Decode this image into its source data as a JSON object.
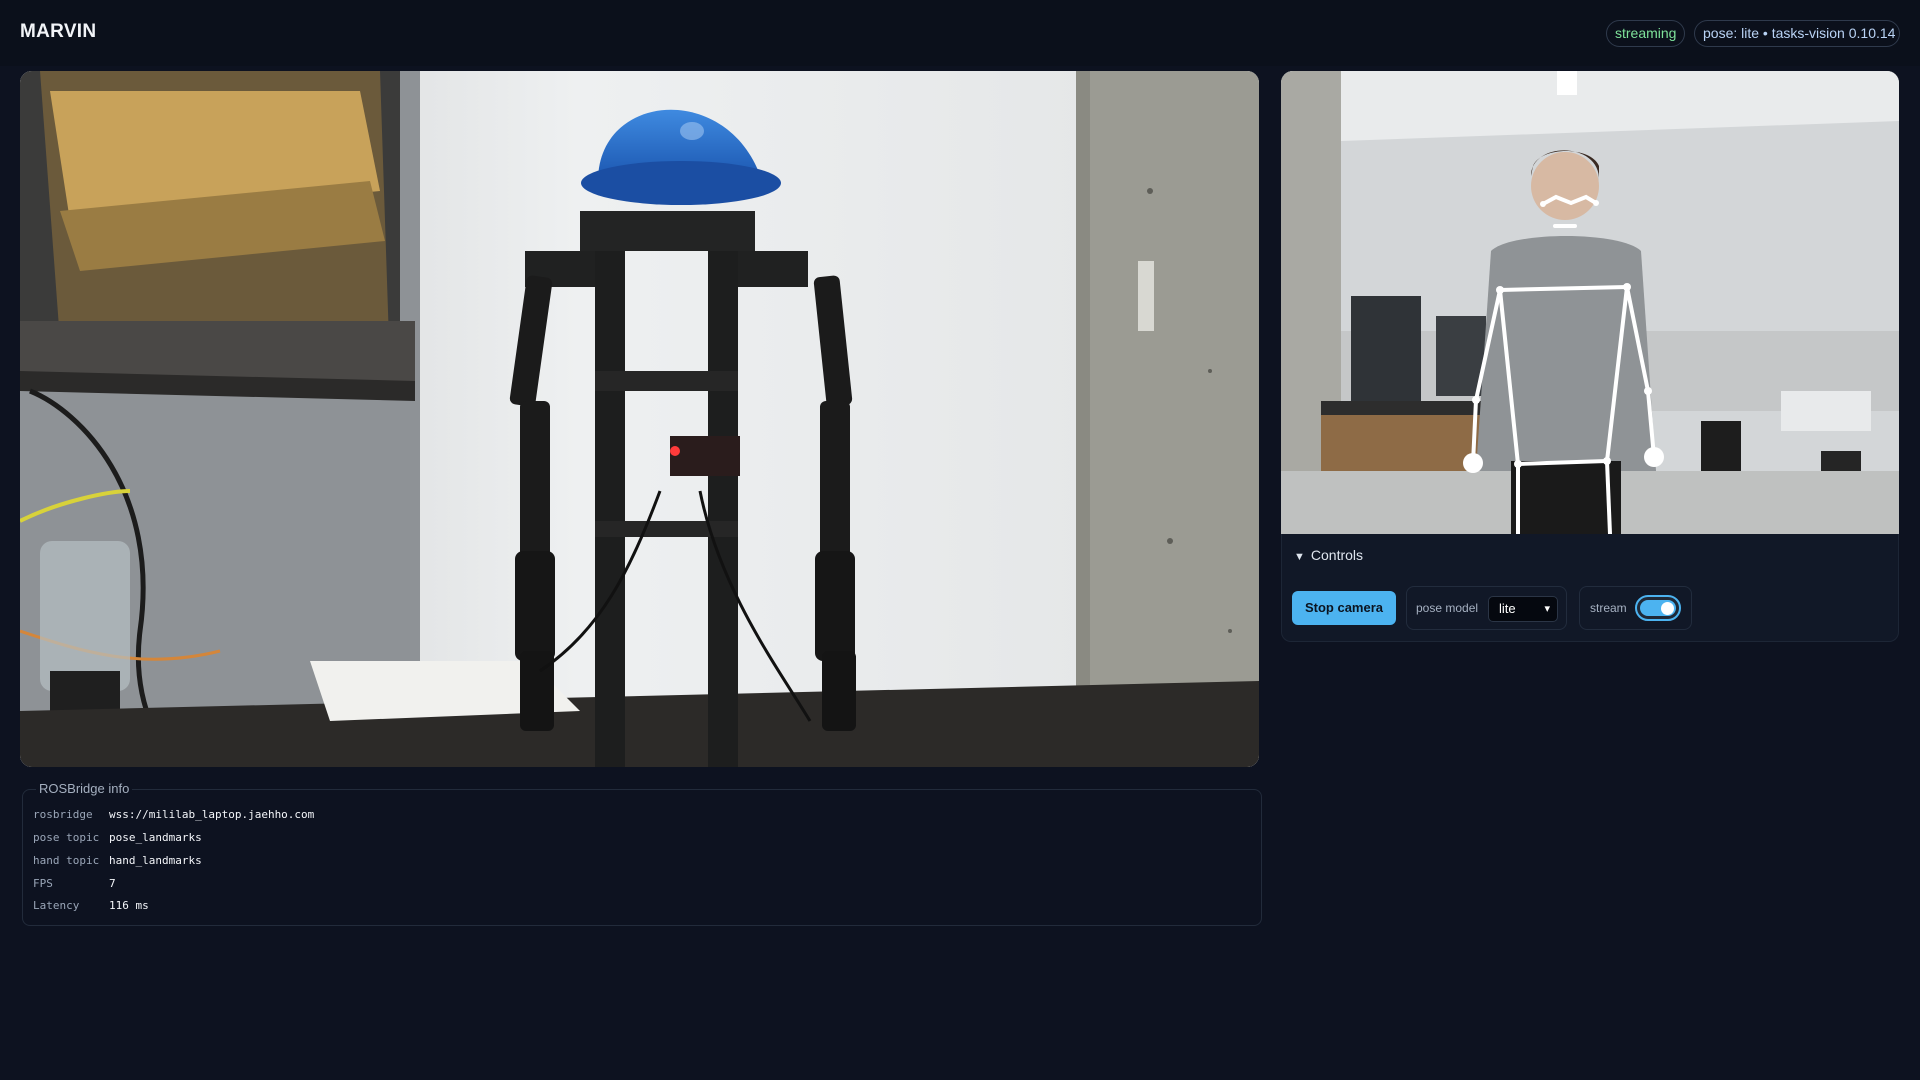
{
  "app": {
    "title": "MARVIN"
  },
  "header": {
    "status_badge": "streaming",
    "pose_badge": "pose: lite • tasks-vision 0.10.14",
    "colors": {
      "status": "#7ee29a",
      "pose": "#b9d3f5"
    }
  },
  "controls": {
    "summary": "Controls",
    "stop_label": "Stop camera",
    "pose_model_label": "pose model",
    "pose_model_value": "lite",
    "stream_label": "stream",
    "stream_on": true
  },
  "ros": {
    "legend": "ROSBridge info",
    "rows": [
      {
        "key": "rosbridge",
        "value": "wss://mililab_laptop.jaehho.com"
      },
      {
        "key": "pose topic",
        "value": "pose_landmarks"
      },
      {
        "key": "hand topic",
        "value": "hand_landmarks"
      },
      {
        "key": "FPS",
        "value": "7"
      },
      {
        "key": "Latency",
        "value": "116 ms"
      }
    ]
  },
  "icons": {
    "disclosure": "triangle-down-icon",
    "select": "chevron-down-icon"
  },
  "theme": {
    "accent": "#4cb3f0",
    "background": "#0d1220",
    "panel": "#111827"
  }
}
